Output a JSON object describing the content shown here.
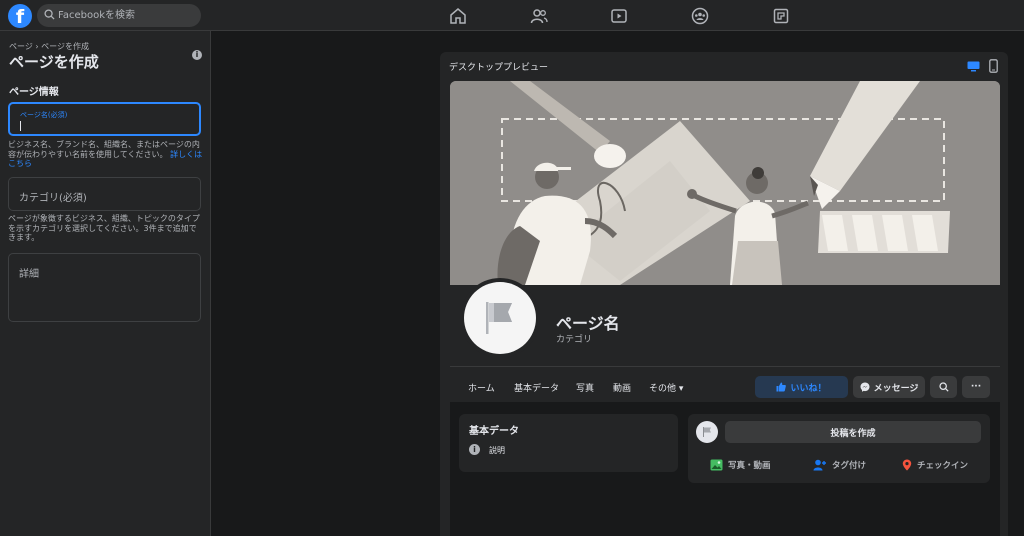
{
  "topbar": {
    "logo": "f",
    "search_placeholder": "Facebookを検索",
    "nav_icons": [
      "home-icon",
      "friends-icon",
      "watch-icon",
      "groups-icon",
      "gaming-icon"
    ]
  },
  "sidebar": {
    "breadcrumb": "ページ › ページを作成",
    "title": "ページを作成",
    "info_icon": "i",
    "section_title": "ページ情報",
    "page_name_label": "ページ名(必須)",
    "page_name_help": "ビジネス名、ブランド名、組織名、またはページの内容が伝わりやすい名前を使用してください。",
    "page_name_help_link": "詳しくはこちら",
    "category_placeholder": "カテゴリ(必須)",
    "category_help": "ページが象徴するビジネス、組織、トピックのタイプを示すカテゴリを選択してください。3件まで追加できます。",
    "details_placeholder": "詳細"
  },
  "preview": {
    "title": "デスクトッププレビュー",
    "page_name": "ページ名",
    "category": "カテゴリ",
    "tabs": [
      "ホーム",
      "基本データ",
      "写真",
      "動画",
      "その他 ▾"
    ],
    "like_label": "いいね！",
    "message_label": "メッセージ",
    "more_label": "···",
    "about_title": "基本データ",
    "about_info_icon": "i",
    "about_desc": "説明",
    "create_post_label": "投稿を作成",
    "post_actions": [
      "写真・動画",
      "タグ付け",
      "チェックイン"
    ]
  },
  "colors": {
    "accent": "#2d88ff",
    "background": "#18191a",
    "surface": "#242526",
    "cover": "#908d8a"
  }
}
